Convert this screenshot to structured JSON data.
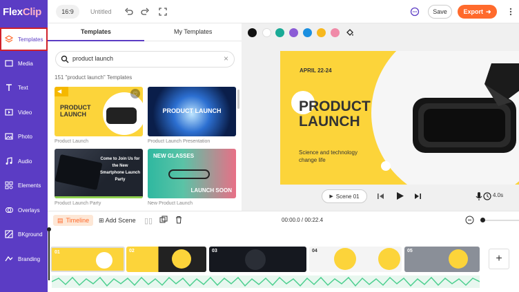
{
  "app": {
    "logo": "FlexClip"
  },
  "topbar": {
    "ratio": "16:9",
    "title": "Untitled",
    "save": "Save",
    "export": "Export"
  },
  "sidebar": {
    "items": [
      {
        "label": "Templates",
        "icon": "templates-icon"
      },
      {
        "label": "Media",
        "icon": "media-icon"
      },
      {
        "label": "Text",
        "icon": "text-icon"
      },
      {
        "label": "Video",
        "icon": "video-icon"
      },
      {
        "label": "Photo",
        "icon": "photo-icon"
      },
      {
        "label": "Audio",
        "icon": "audio-icon"
      },
      {
        "label": "Elements",
        "icon": "elements-icon"
      },
      {
        "label": "Overlays",
        "icon": "overlays-icon"
      },
      {
        "label": "BKground",
        "icon": "background-icon"
      },
      {
        "label": "Branding",
        "icon": "branding-icon"
      }
    ]
  },
  "panel": {
    "tabs": [
      "Templates",
      "My Templates"
    ],
    "search_value": "product launch",
    "count": "151 \"product launch\" Templates",
    "cards": [
      {
        "label": "Product Launch",
        "text": "PRODUCT LAUNCH"
      },
      {
        "label": "Product Launch Presentation",
        "text": "PRODUCT LAUNCH"
      },
      {
        "label": "Product Launch Party",
        "text": "Come to Join Us for the New Smartphone Launch Party"
      },
      {
        "label": "New Product Launch",
        "text_top": "NEW GLASSES",
        "text_bottom": "LAUNCH SOON"
      }
    ]
  },
  "colors": [
    "#111111",
    "#ffffff",
    "#1aaa96",
    "#8b5cd6",
    "#1b8fe0",
    "#f7b81e",
    "#f08aa8"
  ],
  "preview": {
    "date": "APRIL 22-24",
    "title_line1": "PRODUCT",
    "title_line2": "LAUNCH",
    "subtitle_line1": "Science and technology",
    "subtitle_line2": "change life"
  },
  "controls": {
    "scene": "Scene 01",
    "duration": "4.0s"
  },
  "timeline": {
    "timeline_label": "Timeline",
    "add_scene": "Add Scene",
    "time": "00:00.0 / 00:22.4",
    "clips": [
      "01",
      "02",
      "03",
      "04",
      "05"
    ]
  },
  "theme": {
    "brand": "#5b3cc4",
    "accent": "#ff6a2c",
    "yellow": "#fcd43a"
  }
}
